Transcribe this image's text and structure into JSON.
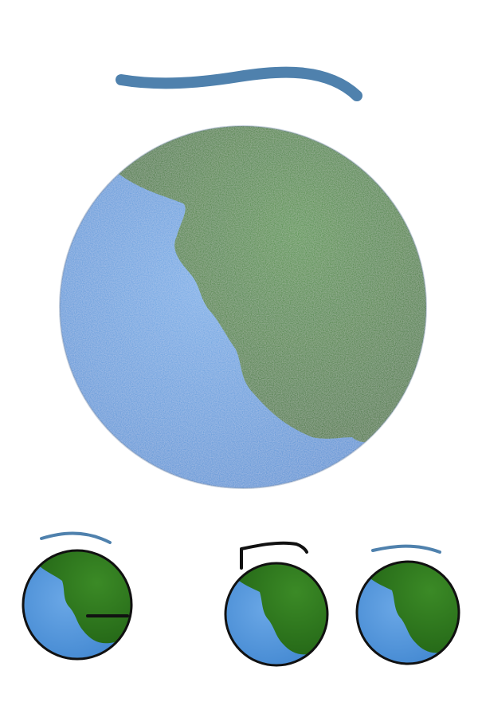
{
  "drawing": {
    "colors": {
      "paper": "#ffffff",
      "ocean": "#4a90d6",
      "ocean_light": "#6aa7e6",
      "land": "#2f7d1f",
      "land_dark": "#246a18",
      "ink": "#111111",
      "swoosh": "#4f81ad"
    },
    "icons": [
      "large-earth-globe",
      "small-earth-globe",
      "blue-swoosh-stroke",
      "black-hook-stroke"
    ]
  }
}
